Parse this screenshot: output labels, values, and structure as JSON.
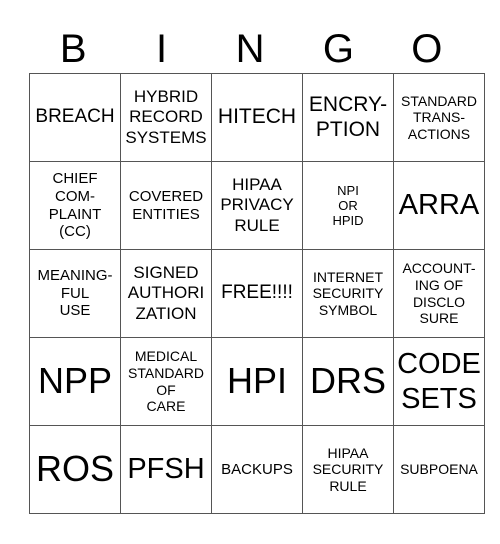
{
  "header": [
    "B",
    "I",
    "N",
    "G",
    "O"
  ],
  "cells": [
    [
      "BREACH",
      "HYBRID\nRECORD\nSYSTEMS",
      "HITECH",
      "ENCRY-\nPTION",
      "STANDARD\nTRANS-\nACTIONS"
    ],
    [
      "CHIEF\nCOM-\nPLAINT\n(CC)",
      "COVERED\nENTITIES",
      "HIPAA\nPRIVACY\nRULE",
      "NPI\nOR\nHPID",
      "ARRA"
    ],
    [
      "MEANING-\nFUL\nUSE",
      "SIGNED\nAUTHORI\nZATION",
      "FREE!!!!",
      "INTERNET\nSECURITY\nSYMBOL",
      "ACCOUNT-\nING OF\nDISCLO\nSURE"
    ],
    [
      "NPP",
      "MEDICAL\nSTANDARD\nOF\nCARE",
      "HPI",
      "DRS",
      "CODE\nSETS"
    ],
    [
      "ROS",
      "PFSH",
      "BACKUPS",
      "HIPAA\nSECURITY\nRULE",
      "SUBPOENA"
    ]
  ]
}
